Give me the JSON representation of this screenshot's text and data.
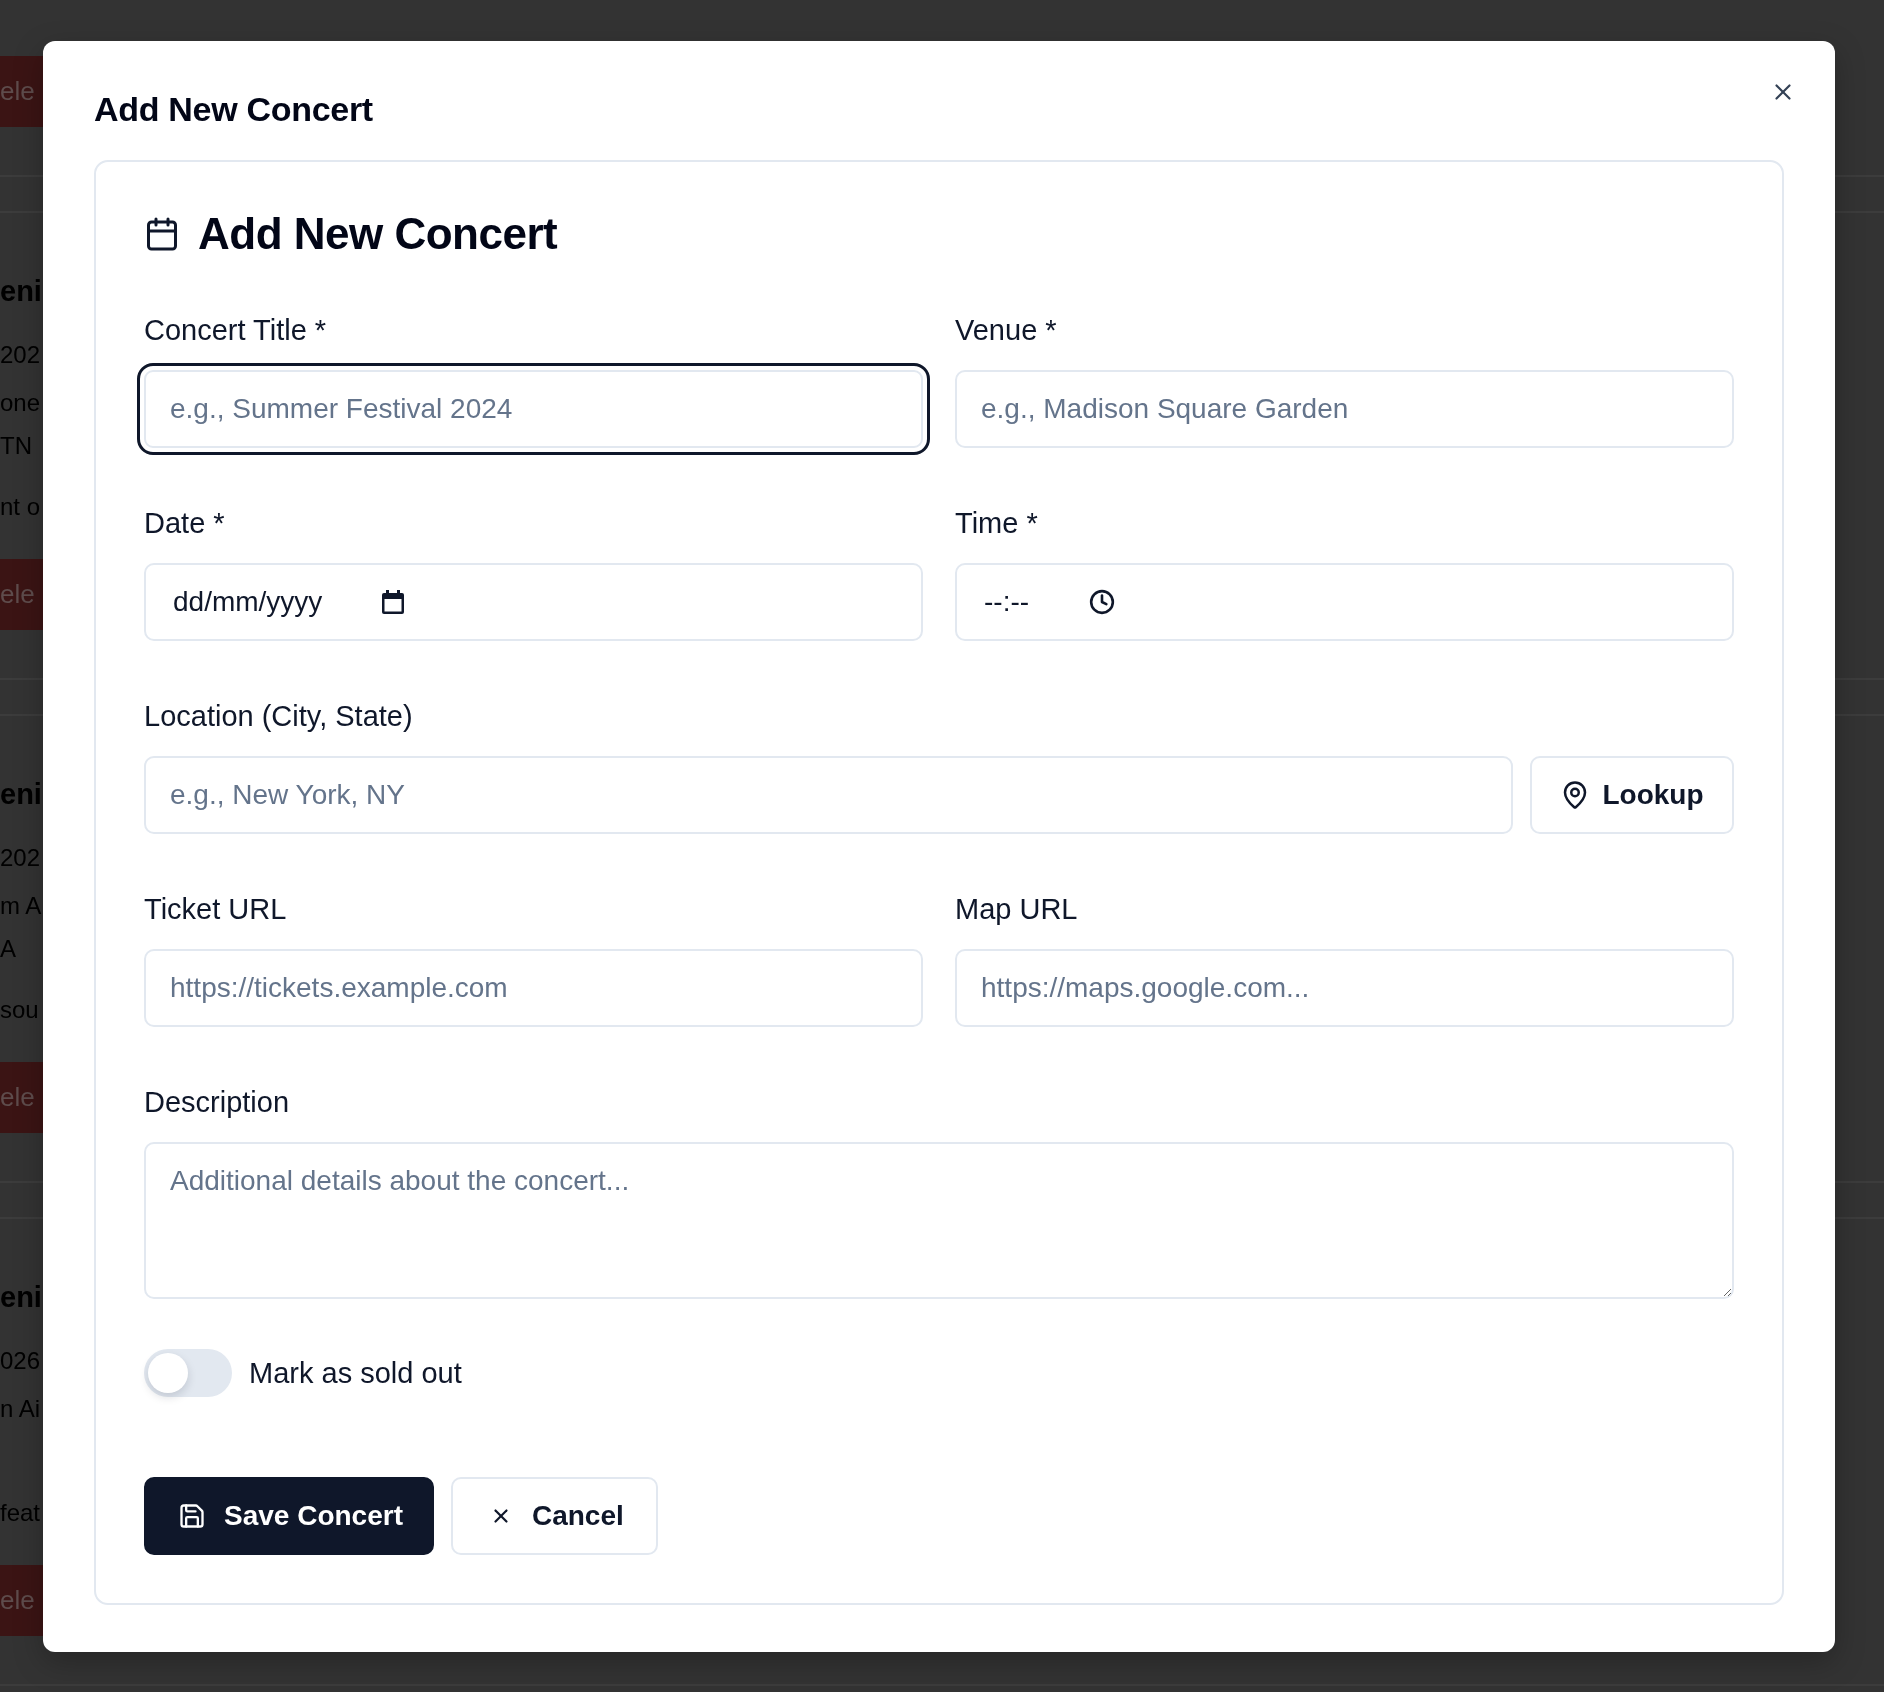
{
  "background_page": {
    "cards": [
      {
        "button": "ele"
      },
      {
        "title": "eni",
        "line_1": "202",
        "line_2": "one",
        "line_3": "TN",
        "line_4": "nt o",
        "button": "ele"
      },
      {
        "title": "eni",
        "line_1": "202",
        "line_2": "m A",
        "line_3": "A",
        "line_4": "sou",
        "button": "ele"
      },
      {
        "title": "eni",
        "line_1": "026",
        "line_2": "n Ai",
        "line_4": "feat",
        "button": "ele"
      }
    ]
  },
  "dialog": {
    "title": "Add New Concert"
  },
  "form": {
    "heading": "Add New Concert",
    "rows": [
      {
        "fields": [
          {
            "kind": "text",
            "label": "Concert Title *",
            "placeholder": "e.g., Summer Festival 2024",
            "focused": true
          },
          {
            "kind": "text",
            "label": "Venue *",
            "placeholder": "e.g., Madison Square Garden",
            "focused": false
          }
        ]
      },
      {
        "fields": [
          {
            "kind": "date",
            "label": "Date *",
            "value": "dd/mm/yyyy",
            "focused": false
          },
          {
            "kind": "time",
            "label": "Time *",
            "value": "--:--",
            "focused": false
          }
        ]
      },
      {
        "fields": [
          {
            "kind": "lookup",
            "label": "Location (City, State)",
            "placeholder": "e.g., New York, NY",
            "button": "Lookup",
            "focused": false
          }
        ]
      },
      {
        "fields": [
          {
            "kind": "text",
            "label": "Ticket URL",
            "placeholder": "https://tickets.example.com",
            "focused": false
          },
          {
            "kind": "text",
            "label": "Map URL",
            "placeholder": "https://maps.google.com...",
            "focused": false
          }
        ]
      },
      {
        "fields": [
          {
            "kind": "textarea",
            "label": "Description",
            "placeholder": "Additional details about the concert...",
            "focused": false
          }
        ]
      }
    ],
    "sold_out": {
      "label": "Mark as sold out",
      "on": false
    },
    "buttons": [
      {
        "kind": "primary",
        "label": "Save Concert"
      },
      {
        "kind": "outline",
        "label": "Cancel"
      }
    ]
  }
}
